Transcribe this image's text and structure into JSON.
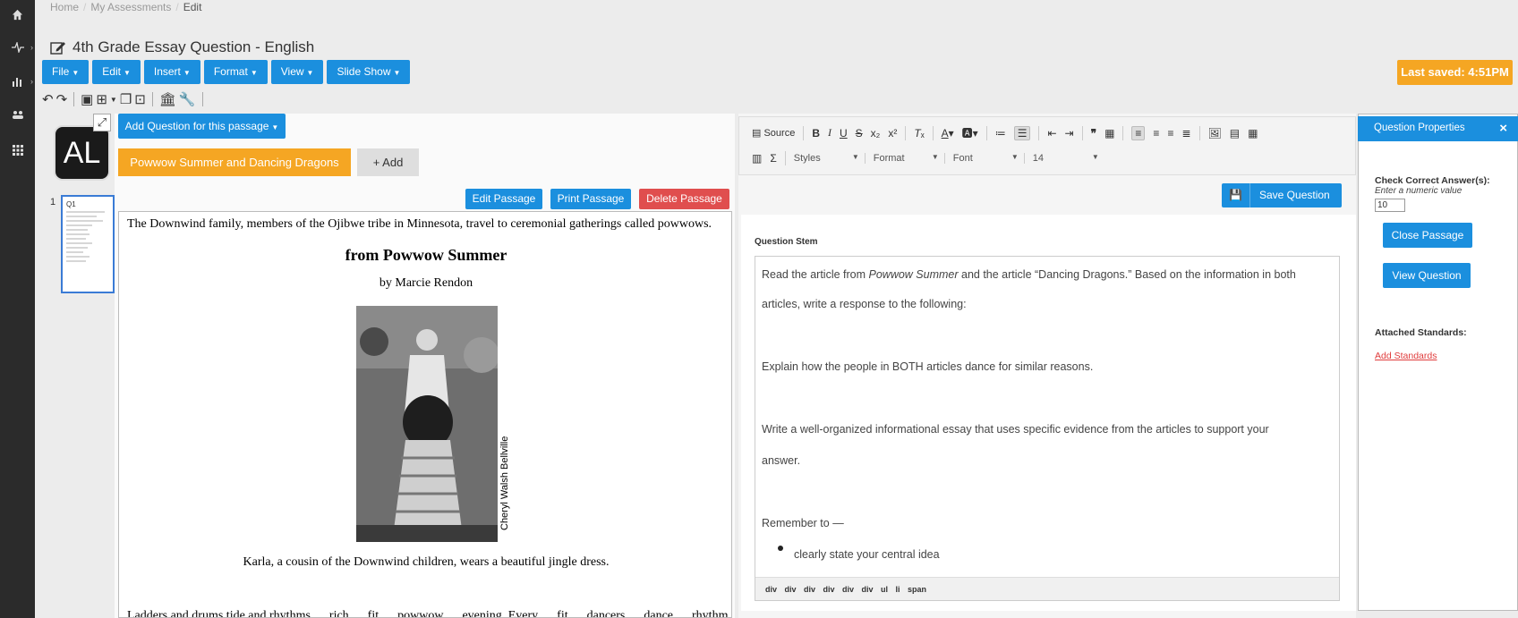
{
  "breadcrumb": [
    "Home",
    "My Assessments",
    "Edit"
  ],
  "page_title": "4th Grade Essay Question - English",
  "menubar": [
    "File",
    "Edit",
    "Insert",
    "Format",
    "View",
    "Slide Show"
  ],
  "last_saved": "Last saved: 4:51PM",
  "thumbnails": {
    "logo_text": "AL",
    "slide_number": "1",
    "slide_label": "Q1"
  },
  "passage": {
    "add_question": "Add Question for this passage",
    "tab": "Powwow Summer and Dancing Dragons",
    "add_tab": "+ Add",
    "edit": "Edit Passage",
    "print": "Print Passage",
    "delete": "Delete Passage",
    "intro": "The Downwind family, members of the Ojibwe tribe in Minnesota, travel to ceremonial gatherings called powwows.",
    "title": "from Powwow Summer",
    "author": "by Marcie Rendon",
    "photo_credit": "Cheryl Walsh Bellville",
    "caption": "Karla, a cousin of the Downwind children,  wears a beautiful jingle dress.",
    "cut_line": "Ladders and drums tide and rhythms … rich … fit … powwow … evening. Every … fit … dancers … dance … rhythm …"
  },
  "editor": {
    "source": "Source",
    "styles": "Styles",
    "format": "Format",
    "font": "Font",
    "size": "14",
    "save": "Save Question",
    "stem_label": "Question Stem",
    "lines": {
      "p1a_pre": "Read the article from ",
      "p1a_em": "Powwow Summer",
      "p1a_post": " and the article “Dancing Dragons.” Based on the information in both",
      "p1b": "articles, write a response to the following:",
      "p2": "Explain how the people in BOTH articles dance for similar reasons.",
      "p3a": "Write a well-organized informational essay that uses specific evidence from the articles to support your",
      "p3b": "answer.",
      "p4": "Remember to —",
      "bullet1": "clearly state your central idea"
    },
    "path": "div div div div div div ul li span"
  },
  "properties": {
    "title": "Question Properties",
    "close": "×",
    "check_label": "Check Correct Answer(s):",
    "hint": "Enter a numeric value",
    "value": "10",
    "close_passage": "Close Passage",
    "view_question": "View Question",
    "standards_label": "Attached Standards:",
    "add_standards": "Add Standards"
  },
  "colors": {
    "accent": "#1b8fde",
    "orange": "#f5a623",
    "danger": "#e04e4e"
  }
}
